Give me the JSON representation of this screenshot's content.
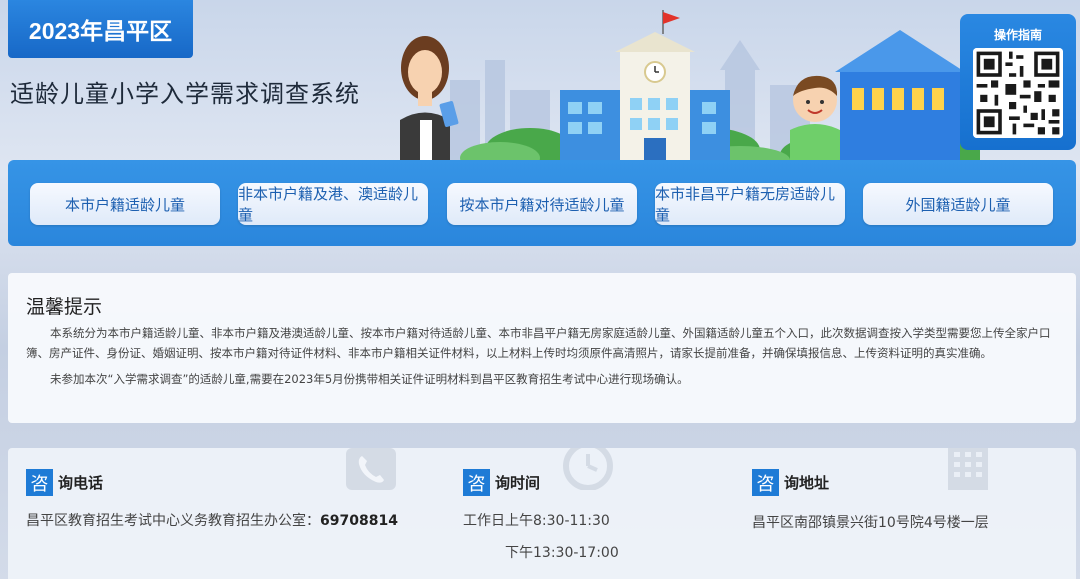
{
  "header": {
    "year_badge": "2023年昌平区",
    "system_title": "适龄儿童小学入学需求调查系统",
    "guide_title": "操作指南"
  },
  "nav": {
    "items": [
      {
        "label": "本市户籍适龄儿童"
      },
      {
        "label": "非本市户籍及港、澳适龄儿童"
      },
      {
        "label": "按本市户籍对待适龄儿童"
      },
      {
        "label": "本市非昌平户籍无房适龄儿童"
      },
      {
        "label": "外国籍适龄儿童"
      }
    ]
  },
  "notice": {
    "title": "温馨提示",
    "paragraph1": "本系统分为本市户籍适龄儿童、非本市户籍及港澳适龄儿童、按本市户籍对待适龄儿童、本市非昌平户籍无房家庭适龄儿童、外国籍适龄儿童五个入口，此次数据调查按入学类型需要您上传全家户口簿、房产证件、身份证、婚姻证明、按本市户籍对待证件材料、非本市户籍相关证件材料，以上材料上传时均须原件高清照片，请家长提前准备，并确保填报信息、上传资料证明的真实准确。",
    "paragraph2": "未参加本次“入学需求调查”的适龄儿童,需要在2023年5月份携带相关证件证明材料到昌平区教育招生考试中心进行现场确认。"
  },
  "contact": {
    "zi": "咨",
    "phone": {
      "label": "询电话",
      "text": "昌平区教育招生考试中心义务教育招生办公室：",
      "number": "69708814"
    },
    "time": {
      "label": "询时间",
      "line1": "工作日上午8:30-11:30",
      "line2": "下午13:30-17:00"
    },
    "address": {
      "label": "询地址",
      "text": "昌平区南邵镇景兴街10号院4号楼一层"
    }
  },
  "colors": {
    "primary": "#1e7bd6",
    "nav_bg": "#3694e6",
    "nav_text": "#1c5fb0"
  }
}
